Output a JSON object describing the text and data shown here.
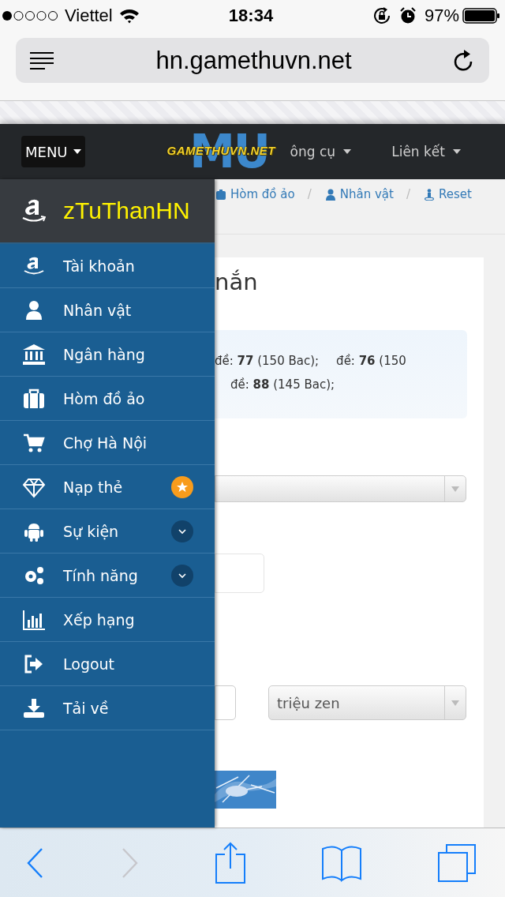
{
  "status_bar": {
    "carrier": "Viettel",
    "time": "18:34",
    "battery": "97%"
  },
  "address_bar": {
    "url": "hn.gamethuvn.net"
  },
  "navbar": {
    "menu_button": "MENU",
    "logo": {
      "backdrop": "MU",
      "text": "GAMETHUVN.NET"
    },
    "links": [
      {
        "label": "ông cụ"
      },
      {
        "label": "Liên kết"
      }
    ]
  },
  "breadcrumb": {
    "separator": "/",
    "items": [
      {
        "label": "Hòm đồ ảo"
      },
      {
        "label": "Nhân vật"
      },
      {
        "label": "Reset"
      }
    ]
  },
  "sidebar": {
    "username": "zTuThanHN",
    "items": [
      {
        "label": "Tài khoản",
        "kind": "plain"
      },
      {
        "label": "Nhân vật",
        "kind": "plain"
      },
      {
        "label": "Ngân hàng",
        "kind": "plain"
      },
      {
        "label": "Hòm đồ ảo",
        "kind": "plain"
      },
      {
        "label": "Chợ Hà Nội",
        "kind": "plain"
      },
      {
        "label": "Nạp thẻ",
        "kind": "starred"
      },
      {
        "label": "Sự kiện",
        "kind": "submenu"
      },
      {
        "label": "Tính năng",
        "kind": "submenu"
      },
      {
        "label": "Xếp hạng",
        "kind": "plain"
      },
      {
        "label": "Logout",
        "kind": "plain"
      },
      {
        "label": "Tải về",
        "kind": "plain"
      }
    ]
  },
  "content": {
    "heading": "nắn",
    "notice_lines": [
      [
        "đề: **77** (150 Bac);",
        "đề: **76** (150"
      ],
      [
        "đề: **88** (145 Bac);"
      ]
    ],
    "unit_select": "triệu zen"
  },
  "toolbar": {
    "back": {
      "disabled": false
    },
    "forward": {
      "disabled": true
    }
  }
}
